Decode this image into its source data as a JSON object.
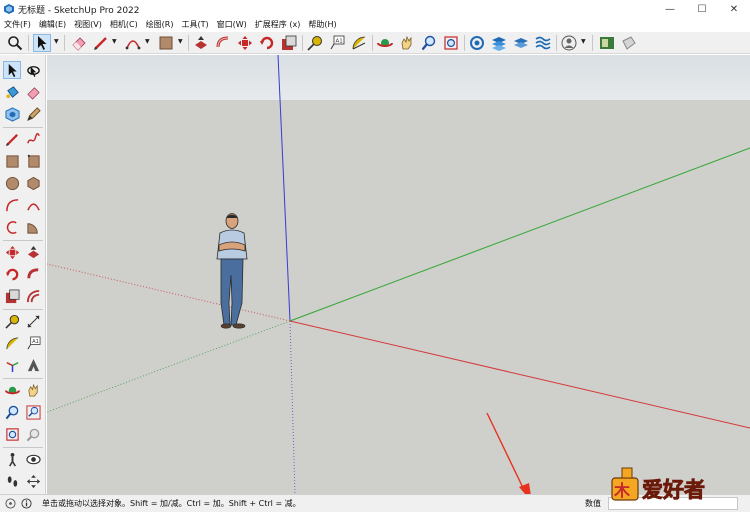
{
  "window": {
    "title": "无标题 - SketchUp Pro 2022",
    "minimize_glyph": "—",
    "maximize_glyph": "☐",
    "close_glyph": "✕"
  },
  "menu": [
    {
      "label": "文件(F)"
    },
    {
      "label": "编辑(E)"
    },
    {
      "label": "视图(V)"
    },
    {
      "label": "相机(C)"
    },
    {
      "label": "绘图(R)"
    },
    {
      "label": "工具(T)"
    },
    {
      "label": "窗口(W)"
    },
    {
      "label": "扩展程序 (x)"
    },
    {
      "label": "帮助(H)"
    }
  ],
  "toolbar_top": {
    "icons": [
      "search-icon",
      "select-arrow-icon",
      "pencil-line-icon",
      "arc-icon",
      "shape-icon",
      "eraser-icon",
      "paint-bucket-icon",
      "push-pull-icon",
      "follow-me-icon",
      "move-icon",
      "rotate-icon",
      "scale-icon",
      "tape-measure-icon",
      "text-label-icon",
      "protractor-icon",
      "orbit-icon",
      "pan-icon",
      "zoom-icon",
      "zoom-extents-icon",
      "warehouse-icon",
      "extension-warehouse-icon",
      "layer-icon",
      "sandbox-icon",
      "profile-icon",
      "styles-icon",
      "sections-icon"
    ]
  },
  "toolbar_left": {
    "icons": [
      "select-icon",
      "lasso-icon",
      "paint-bucket-icon",
      "eraser-icon",
      "component-icon",
      "tag-icon",
      "line-icon",
      "freehand-icon",
      "rectangle-icon",
      "rotated-rectangle-icon",
      "circle-icon",
      "polygon-icon",
      "arc-icon",
      "two-point-arc-icon",
      "three-point-arc-icon",
      "pie-icon",
      "move-icon",
      "push-pull-icon",
      "rotate-icon",
      "follow-me-icon",
      "scale-icon",
      "offset-icon",
      "tape-measure-icon",
      "dimension-icon",
      "protractor-icon",
      "text-icon",
      "axes-icon",
      "3d-text-icon",
      "orbit-icon",
      "pan-icon",
      "zoom-icon",
      "zoom-window-icon",
      "zoom-extents-icon",
      "previous-view-icon",
      "walk-icon",
      "look-around-icon",
      "footprints-icon",
      "section-plane-icon"
    ]
  },
  "status": {
    "hint": "单击或拖动以选择对象。Shift = 加/减。Ctrl = 加。Shift + Ctrl = 减。",
    "measurements_label": "数值",
    "measurements_value": ""
  },
  "colors": {
    "viewport_ground": "#cfcfcc",
    "sky": "#dde2e5",
    "axis_red": "#d43a3a",
    "axis_green": "#2fa52f",
    "axis_blue": "#3a3ad0",
    "arrow_red": "#e8321f"
  },
  "watermark_text": "爱好者"
}
